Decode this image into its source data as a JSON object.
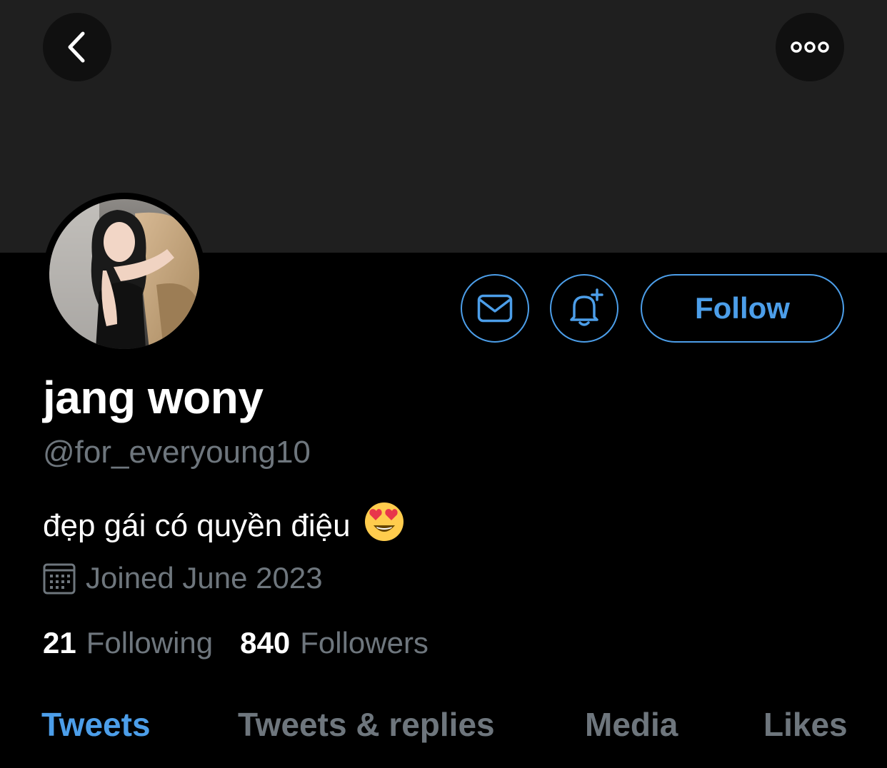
{
  "header": {
    "back_icon": "chevron-left-icon",
    "more_icon": "more-horizontal-icon"
  },
  "profile": {
    "display_name": "jang wony",
    "handle": "@for_everyoung10",
    "bio": "đẹp gái có quyền điệu",
    "bio_emoji": "heart-eyes-emoji",
    "joined": "Joined June 2023",
    "following_count": "21",
    "following_label": "Following",
    "followers_count": "840",
    "followers_label": "Followers"
  },
  "actions": {
    "message_icon": "envelope-icon",
    "notify_icon": "bell-plus-icon",
    "follow_label": "Follow"
  },
  "tabs": [
    {
      "label": "Tweets",
      "active": true
    },
    {
      "label": "Tweets & replies",
      "active": false
    },
    {
      "label": "Media",
      "active": false
    },
    {
      "label": "Likes",
      "active": false
    }
  ],
  "colors": {
    "accent": "#4c9ee9",
    "background": "#000000",
    "banner": "#1f1f1f",
    "muted_text": "#6e767d"
  }
}
